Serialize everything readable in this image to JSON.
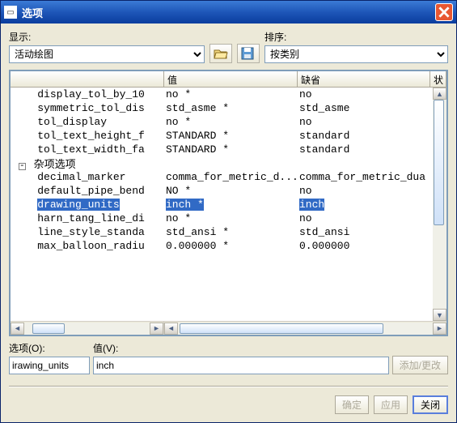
{
  "window": {
    "title": "选项"
  },
  "labels": {
    "display": "显示:",
    "sort": "排序:",
    "option": "选项(O):",
    "value": "值(V):",
    "col_value": "值",
    "col_default": "缺省",
    "col_status": "状",
    "section_misc": "杂项选项"
  },
  "combos": {
    "display_selected": "活动绘图",
    "sort_selected": "按类别"
  },
  "rows": [
    {
      "name": "display_tol_by_10",
      "value": "no *",
      "default": "no"
    },
    {
      "name": "symmetric_tol_dis",
      "value": "std_asme *",
      "default": "std_asme"
    },
    {
      "name": "tol_display",
      "value": "no *",
      "default": "no"
    },
    {
      "name": "tol_text_height_f",
      "value": "STANDARD *",
      "default": "standard"
    },
    {
      "name": "tol_text_width_fa",
      "value": "STANDARD *",
      "default": "standard"
    },
    {
      "section": true,
      "name": "杂项选项"
    },
    {
      "name": "decimal_marker",
      "value": "comma_for_metric_d...",
      "default": "comma_for_metric_dua"
    },
    {
      "name": "default_pipe_bend",
      "value": "NO *",
      "default": "no"
    },
    {
      "name": "drawing_units",
      "value": "inch *",
      "default": "inch",
      "selected": true
    },
    {
      "name": "harn_tang_line_di",
      "value": "no *",
      "default": "no"
    },
    {
      "name": "line_style_standa",
      "value": "std_ansi *",
      "default": "std_ansi"
    },
    {
      "name": "max_balloon_radiu",
      "value": "0.000000 *",
      "default": "0.000000"
    }
  ],
  "edit": {
    "option_value": "irawing_units",
    "value_value": "inch"
  },
  "buttons": {
    "add_change": "添加/更改",
    "ok": "确定",
    "apply": "应用",
    "close": "关闭"
  }
}
